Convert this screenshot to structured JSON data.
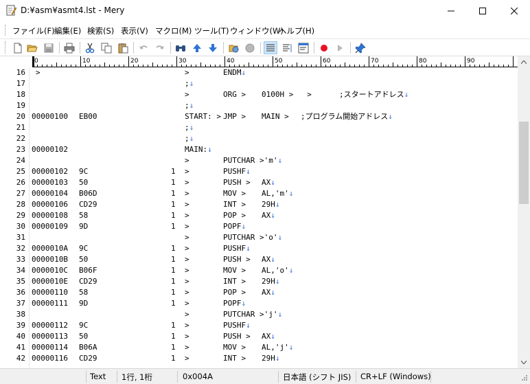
{
  "window": {
    "title": "D:¥asm¥asmt4.lst - Mery"
  },
  "menu": [
    {
      "label": "ファイル(F)",
      "name": "menu-file"
    },
    {
      "label": "編集(E)",
      "name": "menu-edit"
    },
    {
      "label": "検索(S)",
      "name": "menu-search"
    },
    {
      "label": "表示(V)",
      "name": "menu-view"
    },
    {
      "label": "マクロ(M)",
      "name": "menu-macro"
    },
    {
      "label": "ツール(T)",
      "name": "menu-tools"
    },
    {
      "label": "ウィンドウ(W)",
      "name": "menu-window"
    },
    {
      "label": "ヘルプ(H)",
      "name": "menu-help"
    }
  ],
  "toolbar": [
    {
      "icon": "new-file-icon"
    },
    {
      "icon": "open-folder-icon"
    },
    {
      "icon": "save-icon"
    },
    {
      "icon": "print-icon"
    },
    {
      "icon": "cut-icon"
    },
    {
      "icon": "copy-icon"
    },
    {
      "icon": "paste-icon"
    },
    {
      "icon": "undo-icon"
    },
    {
      "icon": "redo-icon"
    },
    {
      "icon": "find-icon"
    },
    {
      "icon": "find-up-icon"
    },
    {
      "icon": "find-down-icon"
    },
    {
      "icon": "open-browser-icon"
    },
    {
      "icon": "stop-icon"
    },
    {
      "icon": "no-wrap-icon"
    },
    {
      "icon": "wrap-window-icon"
    },
    {
      "icon": "wrap-column-icon"
    },
    {
      "icon": "record-macro-icon"
    },
    {
      "icon": "run-macro-icon"
    },
    {
      "icon": "pin-icon"
    }
  ],
  "ruler": {
    "labels": [
      "0",
      "10",
      "20",
      "30",
      "40",
      "50",
      "60",
      "70",
      "80",
      "90"
    ]
  },
  "lines": [
    {
      "n": "16",
      "addr": ">",
      "code": "",
      "cnt": "",
      "label": ">",
      "op": "ENDM↓",
      "args": "",
      "comment": ""
    },
    {
      "n": "17",
      "addr": "",
      "code": "",
      "cnt": "",
      "label": ";↓",
      "op": "",
      "args": "",
      "comment": ""
    },
    {
      "n": "18",
      "addr": "",
      "code": "",
      "cnt": "",
      "label": ">",
      "op": "ORG >",
      "args": "0100H >   >",
      "comment": ";スタートアドレス↓"
    },
    {
      "n": "19",
      "addr": "",
      "code": "",
      "cnt": "",
      "label": ";↓",
      "op": "",
      "args": "",
      "comment": ""
    },
    {
      "n": "20",
      "addr": "00000100",
      "code": "EB00",
      "cnt": "",
      "label": "START: >",
      "op": "JMP >",
      "args": "MAIN >",
      "comment": ";プログラム開始アドレス↓"
    },
    {
      "n": "21",
      "addr": "",
      "code": "",
      "cnt": "",
      "label": ";↓",
      "op": "",
      "args": "",
      "comment": ""
    },
    {
      "n": "22",
      "addr": "",
      "code": "",
      "cnt": "",
      "label": ";↓",
      "op": "",
      "args": "",
      "comment": ""
    },
    {
      "n": "23",
      "addr": "00000102",
      "code": "",
      "cnt": "",
      "label": "MAIN:↓",
      "op": "",
      "args": "",
      "comment": ""
    },
    {
      "n": "24",
      "addr": "",
      "code": "",
      "cnt": "",
      "label": ">",
      "op": "PUTCHAR >'m'↓",
      "args": "",
      "comment": ""
    },
    {
      "n": "25",
      "addr": "00000102",
      "code": "9C",
      "cnt": "1",
      "label": ">",
      "op": "PUSHF↓",
      "args": "",
      "comment": ""
    },
    {
      "n": "26",
      "addr": "00000103",
      "code": "50",
      "cnt": "1",
      "label": ">",
      "op": "PUSH >",
      "args": "AX↓",
      "comment": ""
    },
    {
      "n": "27",
      "addr": "00000104",
      "code": "B06D",
      "cnt": "1",
      "label": ">",
      "op": "MOV >",
      "args": "AL,'m'↓",
      "comment": ""
    },
    {
      "n": "28",
      "addr": "00000106",
      "code": "CD29",
      "cnt": "1",
      "label": ">",
      "op": "INT >",
      "args": "29H↓",
      "comment": ""
    },
    {
      "n": "29",
      "addr": "00000108",
      "code": "58",
      "cnt": "1",
      "label": ">",
      "op": "POP >",
      "args": "AX↓",
      "comment": ""
    },
    {
      "n": "30",
      "addr": "00000109",
      "code": "9D",
      "cnt": "1",
      "label": ">",
      "op": "POPF↓",
      "args": "",
      "comment": ""
    },
    {
      "n": "31",
      "addr": "",
      "code": "",
      "cnt": "",
      "label": ">",
      "op": "PUTCHAR >'o'↓",
      "args": "",
      "comment": ""
    },
    {
      "n": "32",
      "addr": "0000010A",
      "code": "9C",
      "cnt": "1",
      "label": ">",
      "op": "PUSHF↓",
      "args": "",
      "comment": ""
    },
    {
      "n": "33",
      "addr": "0000010B",
      "code": "50",
      "cnt": "1",
      "label": ">",
      "op": "PUSH >",
      "args": "AX↓",
      "comment": ""
    },
    {
      "n": "34",
      "addr": "0000010C",
      "code": "B06F",
      "cnt": "1",
      "label": ">",
      "op": "MOV >",
      "args": "AL,'o'↓",
      "comment": ""
    },
    {
      "n": "35",
      "addr": "0000010E",
      "code": "CD29",
      "cnt": "1",
      "label": ">",
      "op": "INT >",
      "args": "29H↓",
      "comment": ""
    },
    {
      "n": "36",
      "addr": "00000110",
      "code": "58",
      "cnt": "1",
      "label": ">",
      "op": "POP >",
      "args": "AX↓",
      "comment": ""
    },
    {
      "n": "37",
      "addr": "00000111",
      "code": "9D",
      "cnt": "1",
      "label": ">",
      "op": "POPF↓",
      "args": "",
      "comment": ""
    },
    {
      "n": "38",
      "addr": "",
      "code": "",
      "cnt": "",
      "label": ">",
      "op": "PUTCHAR >'j'↓",
      "args": "",
      "comment": ""
    },
    {
      "n": "39",
      "addr": "00000112",
      "code": "9C",
      "cnt": "1",
      "label": ">",
      "op": "PUSHF↓",
      "args": "",
      "comment": ""
    },
    {
      "n": "40",
      "addr": "00000113",
      "code": "50",
      "cnt": "1",
      "label": ">",
      "op": "PUSH >",
      "args": "AX↓",
      "comment": ""
    },
    {
      "n": "41",
      "addr": "00000114",
      "code": "B06A",
      "cnt": "1",
      "label": ">",
      "op": "MOV >",
      "args": "AL,'j'↓",
      "comment": ""
    },
    {
      "n": "42",
      "addr": "00000116",
      "code": "CD29",
      "cnt": "1",
      "label": ">",
      "op": "INT >",
      "args": "29H↓",
      "comment": ""
    }
  ],
  "status": {
    "mode": "Text",
    "position": "1行, 1桁",
    "code": "0x004A",
    "encoding": "日本語 (シフト JIS)",
    "newline": "CR+LF (Windows)"
  },
  "colors": {
    "eol_marker": "#3a6fd8",
    "record": "#e81123",
    "accent": "#0078d7"
  }
}
